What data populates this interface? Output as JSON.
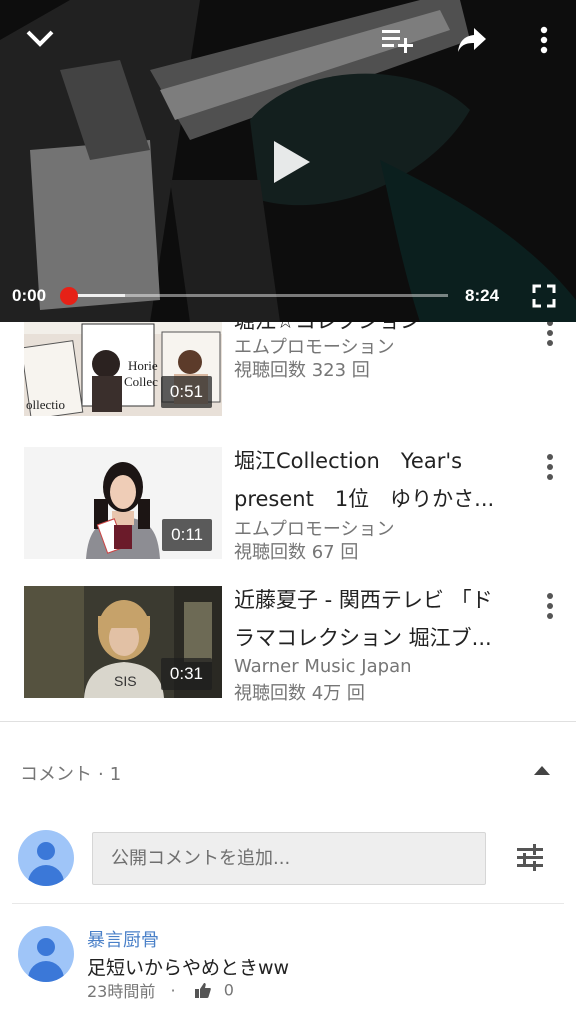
{
  "player": {
    "current_time": "0:00",
    "duration": "8:24",
    "progress": 0.0,
    "buffered": 0.15,
    "icons": [
      "chevron-down-icon",
      "add-to-playlist-icon",
      "share-icon",
      "more-vert-icon",
      "play-icon",
      "fullscreen-icon"
    ],
    "accent_color": "#e62117"
  },
  "related": [
    {
      "title_lines": [
        "堀江☆コレクション",
        ""
      ],
      "channel": "エムプロモーション",
      "views": "視聴回数 323 回",
      "duration": "0:51"
    },
    {
      "title_lines": [
        "堀江Collection　Year's",
        "present　1位　ゆりかさ..."
      ],
      "channel": "エムプロモーション",
      "views": "視聴回数 67 回",
      "duration": "0:11"
    },
    {
      "title_lines": [
        "近藤夏子 - 関西テレビ 「ド",
        "ラマコレクション 堀江ブ..."
      ],
      "channel": "Warner Music Japan",
      "views": "視聴回数 4万 回",
      "duration": "0:31"
    }
  ],
  "comments": {
    "header": "コメント",
    "count": "1",
    "input_placeholder": "公開コメントを追加...",
    "items": [
      {
        "author": "暴言厨骨",
        "text": "足短いからやめときww",
        "time": "23時間前",
        "likes": "0"
      }
    ]
  }
}
